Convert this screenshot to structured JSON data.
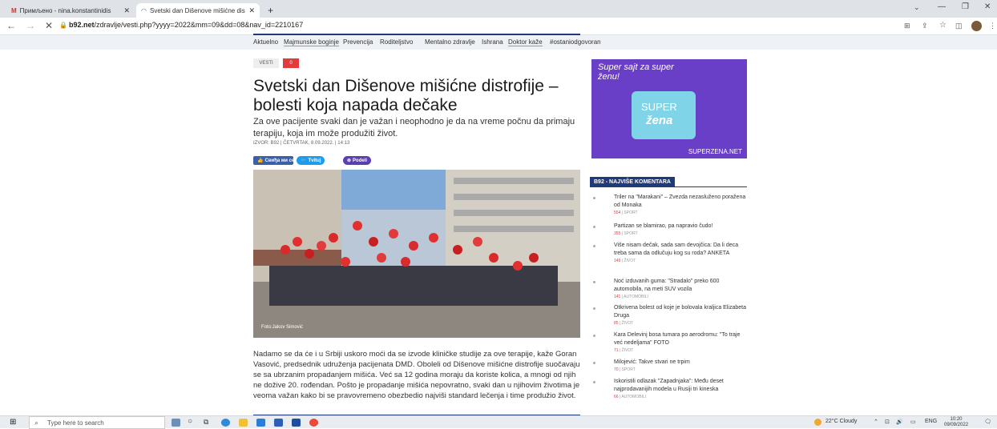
{
  "browser": {
    "tabs": [
      {
        "label": "Примљено - nina.konstantinidis",
        "active": false
      },
      {
        "label": "Svetski dan Dišenove mišićne dis",
        "active": true
      }
    ],
    "new_tab": "+",
    "url_domain": "b92.net",
    "url_path": "/zdravlje/vesti.php?yyyy=2022&mm=09&dd=08&nav_id=2210167"
  },
  "site_nav": [
    "Aktuelno",
    "Majmunske boginje",
    "Prevencija",
    "Roditeljstvo",
    "Mentalno zdravlje",
    "Ishrana",
    "Doktor kaže",
    "#ostaniodgovoran"
  ],
  "article": {
    "tag": "VESTI",
    "comments_count": "0",
    "title": "Svetski dan Dišenove mišićne distrofije – bolesti koja napada dečake",
    "lead": "Za ove pacijente svaki dan je važan i neophodno je da na vreme počnu da primaju terapiju, koja im može produžiti život.",
    "meta": "IZVOR: B92 | ČETVRTAK, 8.09.2022. | 14:13",
    "share": {
      "facebook": "Cвиђа ми се",
      "twitter": "Tvituj",
      "share": "Podeli"
    },
    "photo_credit": "Foto:Jakov Simović",
    "body": "Nadamo se da će i u Srbiji uskoro moći da se izvode kliničke studije za ove terapije, kaže Goran Vasović, predsednik udruženja pacijenata DMD. Oboleli od Dišenove mišićne distrofije suočavaju se sa ubrzanim propadanjem mišića. Već sa 12 godina moraju da koriste kolica, a mnogi od njih ne dožive 20. rođendan. Pošto je propadanje mišića nepovratno, svaki dan u njihovim životima je veoma važan kako bi se pravovremeno obezbedio najviši standard lečenja i time produžio život."
  },
  "ad": {
    "tagline": "Super sajt za super ženu!",
    "logo_top": "SUPER",
    "logo_bottom": "žena",
    "footer": "SUPERZENA.NET"
  },
  "sidebar": {
    "heading": "B92 - NAJVIŠE KOMENTARA",
    "items": [
      {
        "title": "Triler na \"Marakani\" – Zvezda nezasluženo poražena od Monaka",
        "count": "554",
        "section": "SPORT"
      },
      {
        "title": "Partizan se blamirao, pa napravio čudo!",
        "count": "355",
        "section": "SPORT"
      },
      {
        "title": "Više nisam dečak, sada sam devojčica: Da li deca treba sama da odlučuju kog su roda? ANKETA",
        "count": "149",
        "section": "ŽIVOT"
      },
      {
        "title": "Noć izduvanih guma: \"Stradalo\" preko 600 automobila, na meti SUV vozila",
        "count": "141",
        "section": "AUTOMOBILI"
      },
      {
        "title": "Otkrivena bolest od koje je bolovala kraljica Elizabeta Druga",
        "count": "85",
        "section": "ŽIVOT"
      },
      {
        "title": "Kara Delevinj bosa tumara po aerodromu: \"To traje već nedeljama\" FOTO",
        "count": "71",
        "section": "ŽIVOT"
      },
      {
        "title": "Milojević: Takve stvari ne trpim",
        "count": "70",
        "section": "SPORT"
      },
      {
        "title": "Iskoristili odlazak \"Zapadnjaka\": Među deset najprodavanijih modela u Rusiji tri kineska",
        "count": "66",
        "section": "AUTOMOBILI"
      }
    ]
  },
  "taskbar": {
    "search_placeholder": "Type here to search",
    "weather": "22°C  Cloudy",
    "lang": "ENG",
    "time": "10:20",
    "date": "09/09/2022"
  }
}
